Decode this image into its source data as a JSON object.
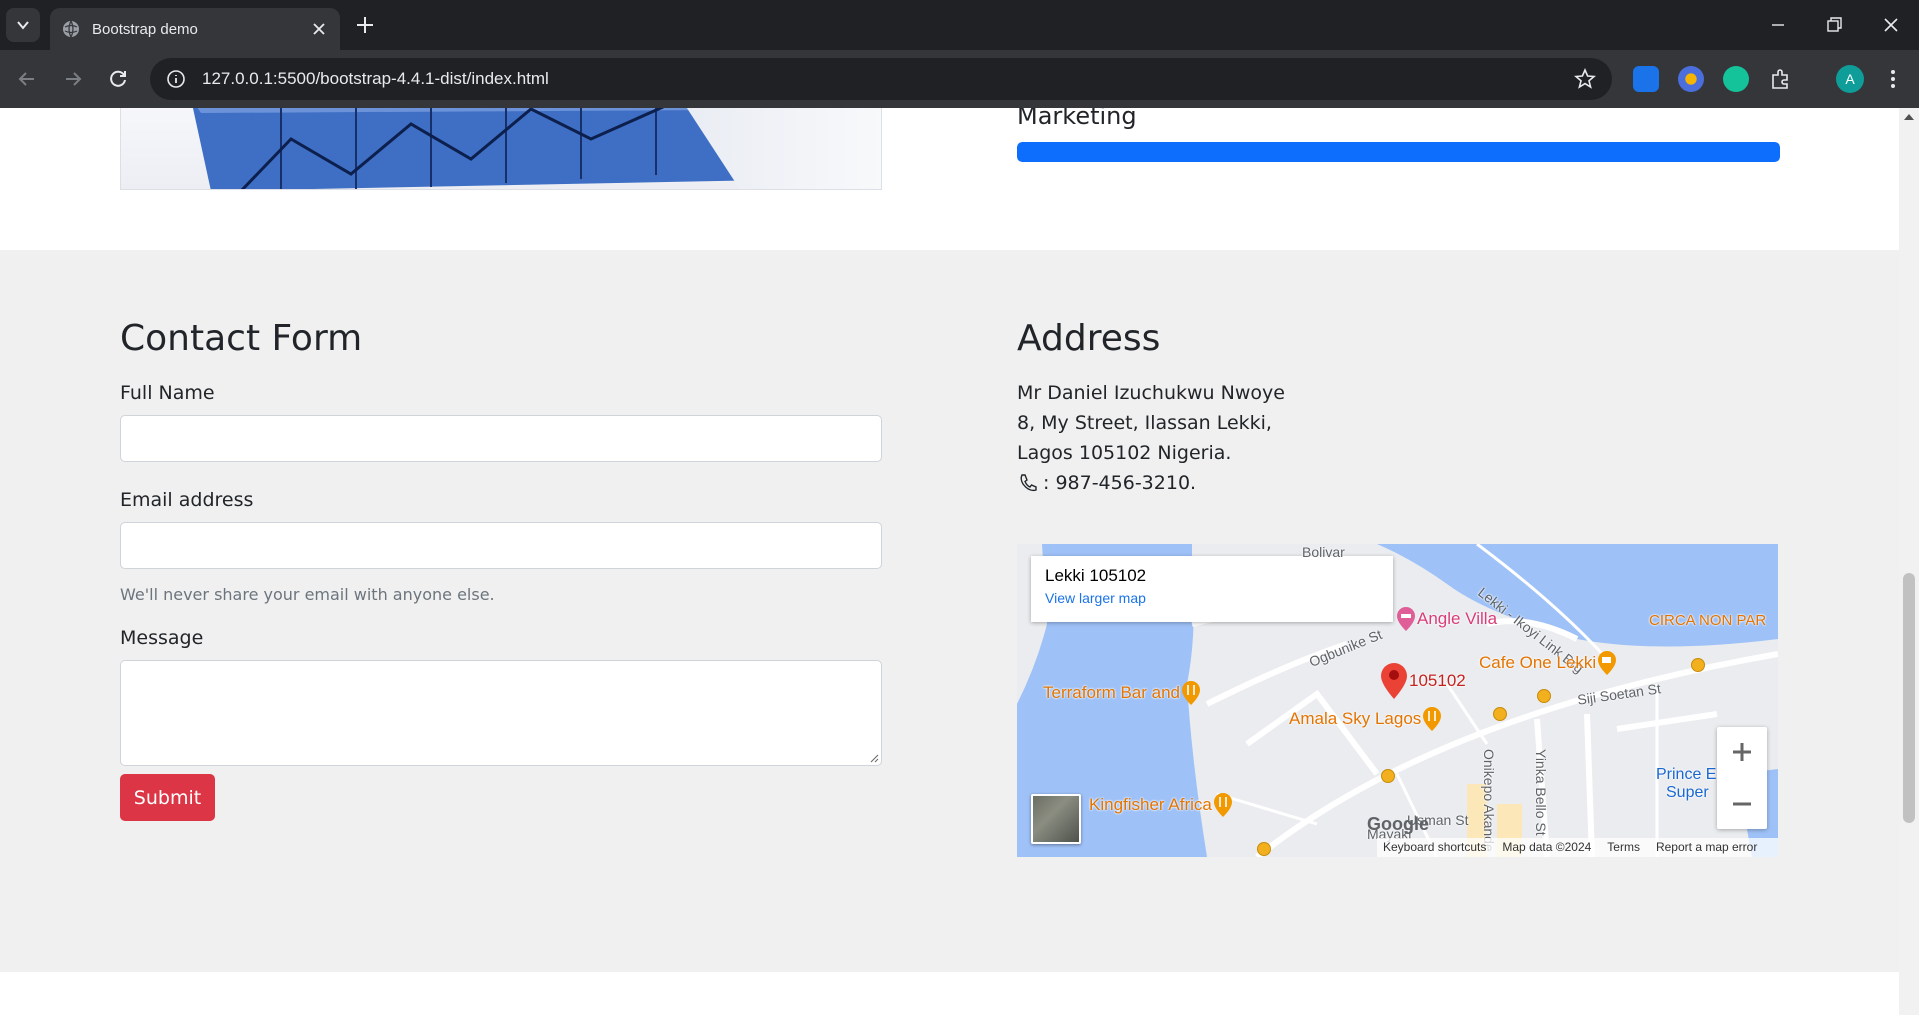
{
  "browser": {
    "tab_title": "Bootstrap demo",
    "url": "127.0.0.1:5500/bootstrap-4.4.1-dist/index.html",
    "profile_initial": "A"
  },
  "progress": {
    "label": "Marketing",
    "value_percent": 100,
    "color": "#0d6efd"
  },
  "contact": {
    "title": "Contact Form",
    "full_name_label": "Full Name",
    "email_label": "Email address",
    "email_help": "We'll never share your email with anyone else.",
    "message_label": "Message",
    "submit_label": "Submit",
    "submit_color": "#dc3545"
  },
  "address": {
    "title": "Address",
    "line1": "Mr Daniel Izuchukwu Nwoye",
    "line2": "8, My Street, Ilassan Lekki,",
    "line3": "Lagos 105102 Nigeria.",
    "phone": ": 987-456-3210."
  },
  "map": {
    "place_title": "Lekki 105102",
    "larger_map_link": "View larger map",
    "pois": {
      "angle_villa": "Angle Villa",
      "circa": "CIRCA NON PAR",
      "cafe_one": "Cafe One Lekki",
      "marker": "105102",
      "terraform": "Terraform Bar and",
      "amala": "Amala Sky Lagos",
      "kingfisher": "Kingfisher Africa",
      "prince": "Prince E",
      "super": "Super"
    },
    "streets": {
      "ogbunike": "Ogbunike St",
      "lekki_link": "Lekki - Ikoyi Link Brg",
      "siji": "Siji Soetan St",
      "onikepo": "Onikepo Akande",
      "yinka": "Yinka Bello St",
      "usman": "Usman St",
      "mayaki": "Mayaki",
      "bolivar": "Bolivar"
    },
    "logo": "Google",
    "footer": {
      "shortcuts": "Keyboard shortcuts",
      "data": "Map data ©2024",
      "terms": "Terms",
      "report": "Report a map error"
    }
  }
}
